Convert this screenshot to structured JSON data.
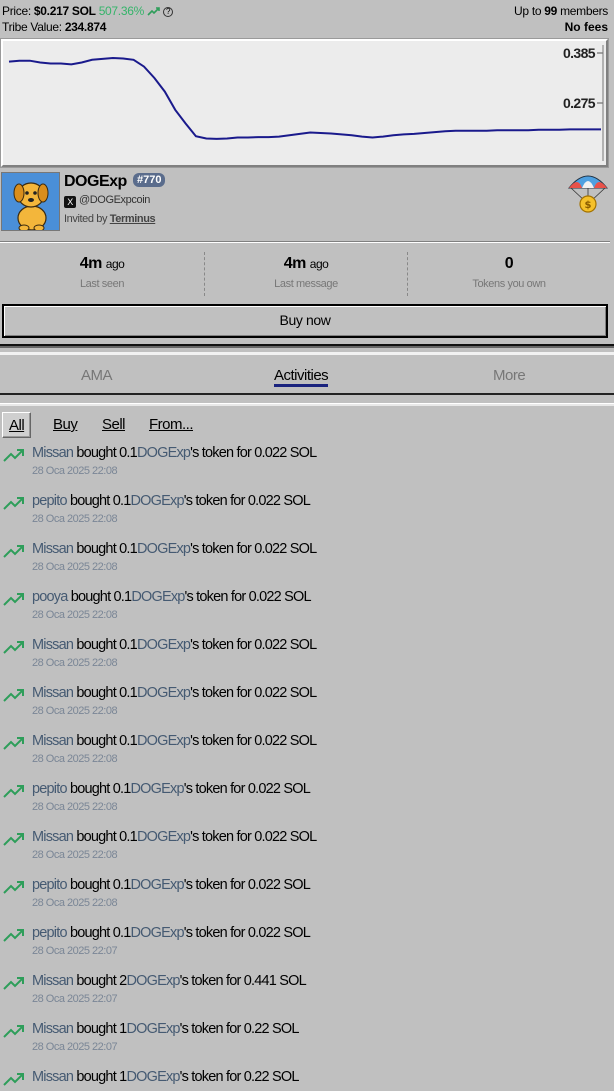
{
  "header": {
    "price_label": "Price:",
    "price_value": "$0.217 SOL",
    "price_change": "507.36%",
    "tribe_label": "Tribe Value:",
    "tribe_value": "234.874",
    "members_prefix": "Up to",
    "members_count": "99",
    "members_suffix": "members",
    "fees": "No fees"
  },
  "chart_data": {
    "type": "line",
    "y_tick_labels": [
      "0.385",
      "0.275"
    ],
    "series": [
      {
        "color": "#1a1a8c",
        "values": [
          0.366,
          0.368,
          0.368,
          0.364,
          0.362,
          0.362,
          0.36,
          0.364,
          0.37,
          0.372,
          0.374,
          0.373,
          0.37,
          0.355,
          0.33,
          0.3,
          0.26,
          0.23,
          0.202,
          0.197,
          0.196,
          0.197,
          0.199,
          0.199,
          0.2,
          0.2,
          0.201,
          0.204,
          0.207,
          0.21,
          0.209,
          0.208,
          0.206,
          0.204,
          0.201,
          0.199,
          0.201,
          0.204,
          0.206,
          0.207,
          0.209,
          0.211,
          0.213,
          0.214,
          0.214,
          0.214,
          0.214,
          0.215,
          0.215,
          0.215,
          0.215,
          0.216,
          0.216,
          0.216,
          0.217,
          0.217,
          0.217,
          0.217
        ]
      }
    ],
    "grid": false
  },
  "profile": {
    "name": "DOGExp",
    "rank": "#770",
    "handle": "@DOGExpcoin",
    "invited_prefix": "Invited by",
    "invited_by": "Terminus"
  },
  "stats": [
    {
      "value": "4m",
      "suffix": "ago",
      "label": "Last seen"
    },
    {
      "value": "4m",
      "suffix": "ago",
      "label": "Last message"
    },
    {
      "value": "0",
      "suffix": "",
      "label": "Tokens you own"
    }
  ],
  "buy_button": "Buy now",
  "tabs": [
    "AMA",
    "Activities",
    "More"
  ],
  "filters": [
    "All",
    "Buy",
    "Sell",
    "From..."
  ],
  "activities": [
    {
      "user": "Missan",
      "verb": "bought",
      "amount": "0.1",
      "token": "DOGExp",
      "tail": "'s token for 0.022 SOL",
      "date": "28 Oca 2025 22:08"
    },
    {
      "user": "pepito",
      "verb": "bought",
      "amount": "0.1",
      "token": "DOGExp",
      "tail": "'s token for 0.022 SOL",
      "date": "28 Oca 2025 22:08"
    },
    {
      "user": "Missan",
      "verb": "bought",
      "amount": "0.1",
      "token": "DOGExp",
      "tail": "'s token for 0.022 SOL",
      "date": "28 Oca 2025 22:08"
    },
    {
      "user": "pooya",
      "verb": "bought",
      "amount": "0.1",
      "token": "DOGExp",
      "tail": "'s token for 0.022 SOL",
      "date": "28 Oca 2025 22:08"
    },
    {
      "user": "Missan",
      "verb": "bought",
      "amount": "0.1",
      "token": "DOGExp",
      "tail": "'s token for 0.022 SOL",
      "date": "28 Oca 2025 22:08"
    },
    {
      "user": "Missan",
      "verb": "bought",
      "amount": "0.1",
      "token": "DOGExp",
      "tail": "'s token for 0.022 SOL",
      "date": "28 Oca 2025 22:08"
    },
    {
      "user": "Missan",
      "verb": "bought",
      "amount": "0.1",
      "token": "DOGExp",
      "tail": "'s token for 0.022 SOL",
      "date": "28 Oca 2025 22:08"
    },
    {
      "user": "pepito",
      "verb": "bought",
      "amount": "0.1",
      "token": "DOGExp",
      "tail": "'s token for 0.022 SOL",
      "date": "28 Oca 2025 22:08"
    },
    {
      "user": "Missan",
      "verb": "bought",
      "amount": "0.1",
      "token": "DOGExp",
      "tail": "'s token for 0.022 SOL",
      "date": "28 Oca 2025 22:08"
    },
    {
      "user": "pepito",
      "verb": "bought",
      "amount": "0.1",
      "token": "DOGExp",
      "tail": "'s token for 0.022 SOL",
      "date": "28 Oca 2025 22:08"
    },
    {
      "user": "pepito",
      "verb": "bought",
      "amount": "0.1",
      "token": "DOGExp",
      "tail": "'s token for 0.022 SOL",
      "date": "28 Oca 2025 22:07"
    },
    {
      "user": "Missan",
      "verb": "bought",
      "amount": "2",
      "token": "DOGExp",
      "tail": "'s token for 0.441 SOL",
      "date": "28 Oca 2025 22:07"
    },
    {
      "user": "Missan",
      "verb": "bought",
      "amount": "1",
      "token": "DOGExp",
      "tail": "'s token for 0.22 SOL",
      "date": "28 Oca 2025 22:07"
    },
    {
      "user": "Missan",
      "verb": "bought",
      "amount": "1",
      "token": "DOGExp",
      "tail": "'s token for 0.22 SOL",
      "date": ""
    }
  ],
  "colors": {
    "background": "#c0c0c0",
    "chart_line": "#1a1a8c",
    "trend_green": "#2e9e5a",
    "positive_pct": "#35b46a",
    "link_blue": "#455a72",
    "tab_underline": "#1a237e"
  }
}
